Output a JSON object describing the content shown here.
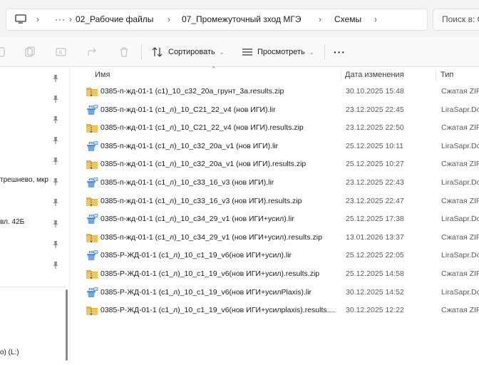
{
  "address_bar": {
    "more_label": "···",
    "crumbs": [
      "02_Рабочие файлы",
      "07_Промежуточный зход МГЭ",
      "Схемы"
    ],
    "search_placeholder": "Поиск в: С"
  },
  "command_bar": {
    "sort_label": "Сортировать",
    "view_label": "Просмотреть",
    "more_label": "···"
  },
  "nav": {
    "items": [
      {
        "label": "",
        "pinned": true
      },
      {
        "label": "",
        "pinned": true
      },
      {
        "label": "",
        "pinned": true
      },
      {
        "label": "",
        "pinned": true
      },
      {
        "label": "",
        "pinned": true
      },
      {
        "label": "трешнево, мкр",
        "pinned": true
      },
      {
        "label": "",
        "pinned": true
      },
      {
        "label": "вл. 42Б",
        "pinned": true
      },
      {
        "label": "",
        "pinned": true
      },
      {
        "label": "",
        "pinned": true
      }
    ],
    "drive_label": "о) (L:)"
  },
  "columns": {
    "name": "Имя",
    "date": "Дата изменения",
    "type": "Тип"
  },
  "files": [
    {
      "name": "0385-п-жд-01-1 (с1)_10_с32_20а_грунт_3а.results.zip",
      "date": "30.10.2025 15:48",
      "type": "Сжатая ZIP",
      "kind": "zip"
    },
    {
      "name": "0385-п-жд-01-1 (с1_л)_10_C21_22_v4 (нов ИГИ).lir",
      "date": "23.12.2025 22:45",
      "type": "LiraSapr.Do",
      "kind": "lir"
    },
    {
      "name": "0385-п-жд-01-1 (с1_л)_10_C21_22_v4 (нов ИГИ).results.zip",
      "date": "23.12.2025 22:50",
      "type": "Сжатая ZIP",
      "kind": "zip"
    },
    {
      "name": "0385-п-жд-01-1 (с1_л)_10_с32_20а_v1 (нов ИГИ).lir",
      "date": "25.12.2025 10:11",
      "type": "LiraSapr.Do",
      "kind": "lir"
    },
    {
      "name": "0385-п-жд-01-1 (с1_л)_10_с32_20а_v1 (нов ИГИ).results.zip",
      "date": "25.12.2025 10:27",
      "type": "Сжатая ZIP",
      "kind": "zip"
    },
    {
      "name": "0385-п-жд-01-1 (с1_л)_10_с33_16_v3 (нов ИГИ).lir",
      "date": "23.12.2025 22:43",
      "type": "LiraSapr.Do",
      "kind": "lir"
    },
    {
      "name": "0385-п-жд-01-1 (с1_л)_10_с33_16_v3 (нов ИГИ).results.zip",
      "date": "23.12.2025 22:47",
      "type": "Сжатая ZIP",
      "kind": "zip"
    },
    {
      "name": "0385-п-жд-01-1 (с1_л)_10_с34_29_v1 (нов ИГИ+усил).lir",
      "date": "25.12.2025 17:38",
      "type": "LiraSapr.Do",
      "kind": "lir"
    },
    {
      "name": "0385-п-жд-01-1 (с1_л)_10_с34_29_v1 (нов ИГИ+усил).results.zip",
      "date": "13.01.2026 13:37",
      "type": "Сжатая ZIP",
      "kind": "zip"
    },
    {
      "name": "0385-Р-ЖД-01-1 (с1_л)_10_с1_19_v6(нов ИГИ+усил).lir",
      "date": "25.12.2025 22:05",
      "type": "LiraSapr.Do",
      "kind": "lir"
    },
    {
      "name": "0385-Р-ЖД-01-1 (с1_л)_10_с1_19_v6(нов ИГИ+усил).results.zip",
      "date": "25.12.2025 14:58",
      "type": "Сжатая ZIP",
      "kind": "zip"
    },
    {
      "name": "0385-Р-ЖД-01-1 (с1_л)_10_с1_19_v6(нов ИГИ+усилPlaxis).lir",
      "date": "30.12.2025 14:52",
      "type": "LiraSapr.Do",
      "kind": "lir"
    },
    {
      "name": "0385-Р-ЖД-01-1 (с1_л)_10_с1_19_v6(нов ИГИ+усилplaxis).results....",
      "date": "30.12.2025 12:22",
      "type": "Сжатая ZIP",
      "kind": "zip"
    }
  ],
  "colors": {
    "zip_folder": "#e8b23a",
    "zip_zipper": "#6b6b6b",
    "lir_blue": "#1f6fd1",
    "accent": "#005fb8"
  },
  "icons": {
    "zip": "zip-folder-icon",
    "lir": "lira-document-icon"
  }
}
